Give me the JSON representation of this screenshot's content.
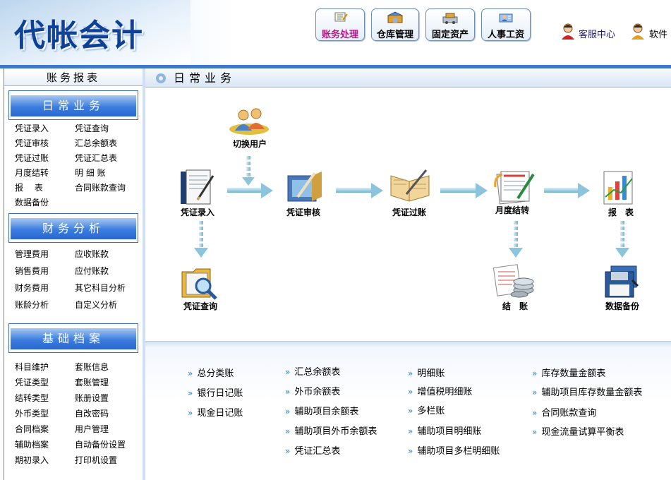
{
  "header": {
    "logo": "代帐会计",
    "nav": [
      {
        "label": "账务处理",
        "icon": "ledger-icon",
        "active": true
      },
      {
        "label": "仓库管理",
        "icon": "warehouse-icon",
        "active": false
      },
      {
        "label": "固定资产",
        "icon": "assets-icon",
        "active": false
      },
      {
        "label": "人事工资",
        "icon": "personnel-icon",
        "active": false
      }
    ],
    "service": "客服中心",
    "software": "软件"
  },
  "sidebar": {
    "title": "账务报表",
    "sections": [
      {
        "title": "日常业务",
        "items": [
          "凭证录入",
          "凭证查询",
          "凭证审核",
          "汇总余额表",
          "凭证过账",
          "凭证汇总表",
          "月度结转",
          "明 细 账",
          "报　 表",
          "合同账款查询",
          "数据备份"
        ]
      },
      {
        "title": "财务分析",
        "items": [
          "管理费用",
          "应收账款",
          "销售费用",
          "应付账款",
          "财务费用",
          "其它科目分析",
          "账龄分析",
          "自定义分析"
        ]
      },
      {
        "title": "基础档案",
        "items": [
          "科目维护",
          "套账信息",
          "凭证类型",
          "套账管理",
          "结转类型",
          "账册设置",
          "外币类型",
          "自改密码",
          "合同档案",
          "用户管理",
          "辅助档案",
          "自动备份设置",
          "期初录入",
          "打印机设置"
        ]
      }
    ]
  },
  "main": {
    "title": "日常业务",
    "flow": {
      "switch_user": "切换用户",
      "entry": "凭证录入",
      "audit": "凭证审核",
      "posting": "凭证过账",
      "month_end": "月度结转",
      "report": "报　表",
      "query": "凭证查询",
      "close": "结　账",
      "backup": "数据备份"
    },
    "links": [
      [
        "总分类账",
        "银行日记账",
        "现金日记账"
      ],
      [
        "汇总余额表",
        "外币余额表",
        "辅助项目余额表",
        "辅助项目外币余额表",
        "凭证汇总表"
      ],
      [
        "明细账",
        "增值税明细账",
        "多栏账",
        "辅助项目明细账",
        "辅助项目多栏明细账"
      ],
      [
        "库存数量金额表",
        "辅助项目库存数量金额表",
        "合同账款查询",
        "现金流量试算平衡表"
      ]
    ]
  },
  "colors": {
    "accent": "#2a67cf",
    "nav_active": "#c0148c",
    "link_chevron": "#2d7dbf"
  }
}
